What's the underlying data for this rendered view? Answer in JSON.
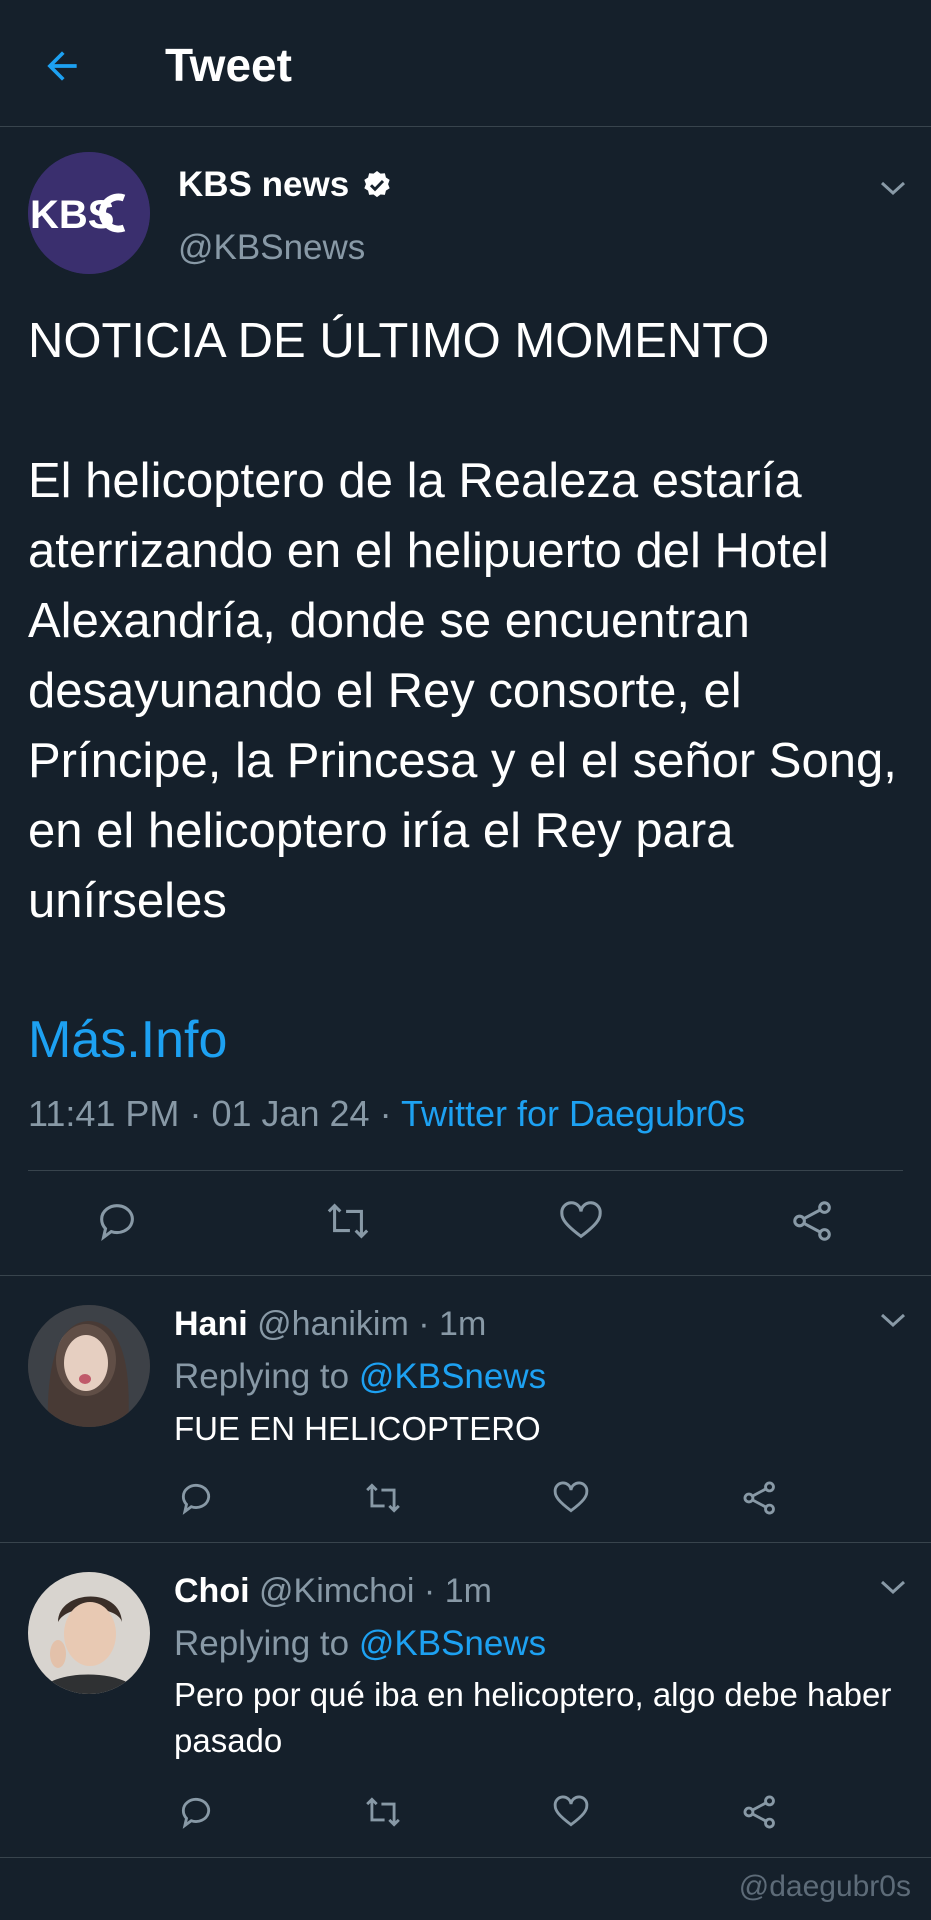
{
  "header": {
    "title": "Tweet",
    "back_icon": "arrow-left-icon"
  },
  "tweet": {
    "display_name": "KBS news",
    "verified_icon": "verified-badge-icon",
    "handle": "@KBSnews",
    "avatar_text": "KBS",
    "text": "NOTICIA DE ÚLTIMO MOMENTO\n\nEl helicoptero de la Realeza estaría aterrizando en el helipuerto del Hotel Alexandría, donde se encuentran desayunando el Rey consorte, el Príncipe, la Princesa y el el señor Song, en el helicoptero iría el Rey para unírseles",
    "more_link": "Más.Info",
    "time": "11:41 PM",
    "date": "01 Jan 24",
    "source": "Twitter for Daegubr0s",
    "actions": [
      "reply-icon",
      "retweet-icon",
      "like-icon",
      "share-icon"
    ]
  },
  "replies": [
    {
      "name": "Hani",
      "handle": "@hanikim",
      "time": "1m",
      "replying_label": "Replying to",
      "replying_to": "@KBSnews",
      "text": "FUE EN HELICOPTERO"
    },
    {
      "name": "Choi",
      "handle": "@Kimchoi",
      "time": "1m",
      "replying_label": "Replying to",
      "replying_to": "@KBSnews",
      "text": "Pero por qué iba en helicoptero, algo debe haber pasado"
    }
  ],
  "watermark": "@daegubr0s",
  "colors": {
    "background": "#15202b",
    "accent": "#1da1f2",
    "muted": "#8899a6"
  }
}
